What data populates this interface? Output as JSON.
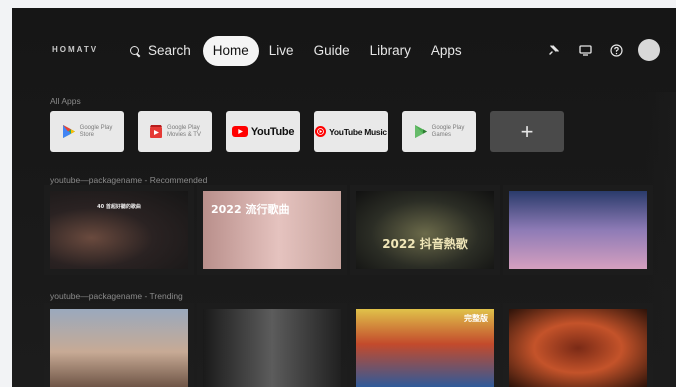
{
  "brand": "HOMATV",
  "nav": {
    "search_label": "Search",
    "items": [
      "Home",
      "Live",
      "Guide",
      "Library",
      "Apps"
    ],
    "active": "Home"
  },
  "status_icons": [
    "input-source-icon",
    "tv-icon",
    "help-icon",
    "avatar"
  ],
  "all_apps": {
    "label": "All Apps",
    "apps": [
      {
        "name": "Google Play",
        "sub": "Store",
        "icon": "play-store-icon"
      },
      {
        "name": "Google Play",
        "sub": "Movies & TV",
        "icon": "play-movies-icon"
      },
      {
        "name": "YouTube",
        "sub": "",
        "icon": "youtube-icon"
      },
      {
        "name": "YouTube Music",
        "sub": "",
        "icon": "youtube-music-icon"
      },
      {
        "name": "Google Play",
        "sub": "Games",
        "icon": "play-games-icon"
      }
    ],
    "add_label": "+"
  },
  "recommended": {
    "label": "youtube—packagename - Recommended",
    "thumbs": [
      {
        "title": "40 首超好聽的歌曲"
      },
      {
        "title": "2022 流行歌曲"
      },
      {
        "title": "2022 抖音熱歌"
      },
      {
        "title": ""
      }
    ]
  },
  "trending": {
    "label": "youtube—packagename - Trending",
    "thumbs": [
      {
        "title": ""
      },
      {
        "title": ""
      },
      {
        "title": "完整版"
      },
      {
        "title": ""
      }
    ]
  },
  "colors": {
    "background": "#1c1c1c",
    "active_pill": "#f5f5f5",
    "youtube_red": "#ff0000"
  }
}
